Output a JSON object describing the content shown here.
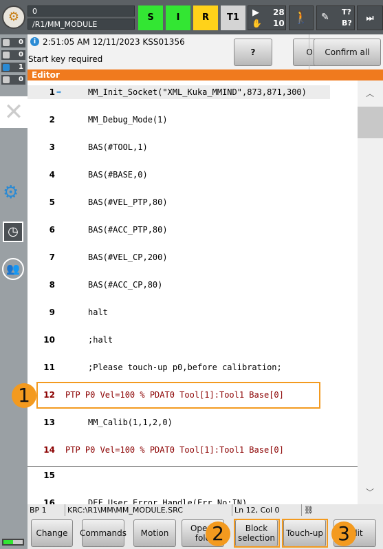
{
  "header": {
    "program_pointer": "0",
    "module_path": "/R1/MM_MODULE",
    "status_s": "S",
    "status_i": "I",
    "status_r": "R",
    "mode": "T1",
    "override_prog": "28",
    "override_jog": "10",
    "tool": "T?",
    "base": "B?"
  },
  "counters": [
    {
      "icon": "ack-icon",
      "value": "0"
    },
    {
      "icon": "warning-icon",
      "value": "0"
    },
    {
      "icon": "info-icon",
      "value": "1"
    },
    {
      "icon": "wait-icon",
      "value": "0"
    }
  ],
  "message": {
    "timestamp": "2:51:05 AM 12/11/2023 KSS01356",
    "text": "Start key required",
    "help": "?",
    "ok": "OK",
    "confirm_all": "Confirm all"
  },
  "editor": {
    "title": "Editor",
    "lines": [
      {
        "n": "1",
        "code": "MM_Init_Socket(\"XML_Kuka_MMIND\",873,871,300)"
      },
      {
        "n": "2",
        "code": "MM_Debug_Mode(1)"
      },
      {
        "n": "3",
        "code": "BAS(#TOOL,1)"
      },
      {
        "n": "4",
        "code": "BAS(#BASE,0)"
      },
      {
        "n": "5",
        "code": "BAS(#VEL_PTP,80)"
      },
      {
        "n": "6",
        "code": "BAS(#ACC_PTP,80)"
      },
      {
        "n": "7",
        "code": "BAS(#VEL_CP,200)"
      },
      {
        "n": "8",
        "code": "BAS(#ACC_CP,80)"
      },
      {
        "n": "9",
        "code": "halt"
      },
      {
        "n": "10",
        "code": ";halt"
      },
      {
        "n": "11",
        "code": ";Please touch-up p0,before calibration;"
      },
      {
        "n": "12",
        "code": "PTP P0 Vel=100 % PDAT0 Tool[1]:Tool1 Base[0]"
      },
      {
        "n": "13",
        "code": "MM_Calib(1,1,2,0)"
      },
      {
        "n": "14",
        "code": "PTP P0 Vel=100 % PDAT0 Tool[1]:Tool1 Base[0]"
      },
      {
        "n": "15",
        "code": ""
      },
      {
        "n": "16",
        "code": "DEF User_Error_Handle(Err_No:IN)"
      }
    ]
  },
  "status": {
    "bp": "BP 1",
    "file": "KRC:\\R1\\MM\\MM_MODULE.SRC",
    "position": "Ln 12, Col 0"
  },
  "buttons": {
    "change": "Change",
    "commands": "Commands",
    "motion": "Motion",
    "open_fold": "Open/ fold",
    "block_selection": "Block selection",
    "touch_up": "Touch-up",
    "edit": "Edit"
  },
  "annotations": [
    "1",
    "2",
    "3"
  ],
  "colors": {
    "accent": "#f07a1e",
    "annotation": "#f39a1f",
    "green": "#33e633",
    "yellow": "#ffd21a",
    "code_red": "#8b0000"
  }
}
